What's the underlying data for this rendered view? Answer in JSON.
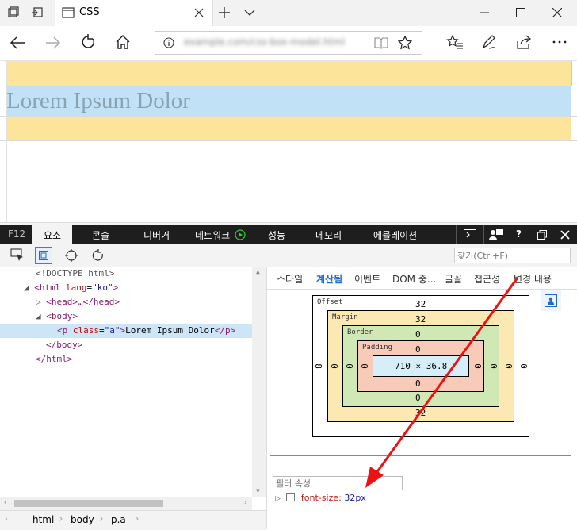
{
  "browser": {
    "tab_title": "CSS",
    "address_url": "example.com/css-box-model.html"
  },
  "page": {
    "lorem_text": "Lorem Ipsum Dolor",
    "colors": {
      "margin": "#fce49a",
      "content": "#c1e2f6"
    }
  },
  "devtools": {
    "tabs": [
      "F12",
      "요소",
      "콘솔",
      "디버거",
      "네트워크",
      "성능",
      "메모리",
      "에뮬레이션"
    ],
    "active_tab": "요소",
    "search_placeholder": "찾기(Ctrl+F)",
    "dom": {
      "doctype": "<!DOCTYPE html>",
      "html_open_tag": "<html",
      "html_attr_name": "lang",
      "html_attr_value": "\"ko\"",
      "head_collapsed": "<head>…</head>",
      "body_open": "<body>",
      "p_open_tag": "<p",
      "p_attr_name": "class",
      "p_attr_value": "\"a\"",
      "p_text": "Lorem Ipsum Dolor",
      "p_close": "</p>",
      "body_close": "</body>",
      "html_close": "</html>"
    },
    "right_tabs": [
      "스타일",
      "계산됨",
      "이벤트",
      "DOM 중...",
      "글꼴",
      "접근성",
      "변경 내용"
    ],
    "active_right_tab": "계산됨",
    "box_model": {
      "offset_label": "Offset",
      "offset_top": "32",
      "offset_left": "8",
      "offset_right": "0",
      "margin_label": "Margin",
      "margin_top": "32",
      "margin_bottom": "32",
      "margin_left": "0",
      "margin_right": "0",
      "border_label": "Border",
      "border_top": "0",
      "border_bottom": "0",
      "border_left": "0",
      "border_right": "0",
      "padding_label": "Padding",
      "padding_top": "0",
      "padding_bottom": "0",
      "padding_left": "0",
      "padding_right": "0",
      "content_size": "710 × 36.8"
    },
    "filter_placeholder": "필터 속성",
    "computed_prop_name": "font-size:",
    "computed_prop_value": "32px",
    "breadcrumbs": [
      "html",
      "body",
      "p.a"
    ]
  }
}
